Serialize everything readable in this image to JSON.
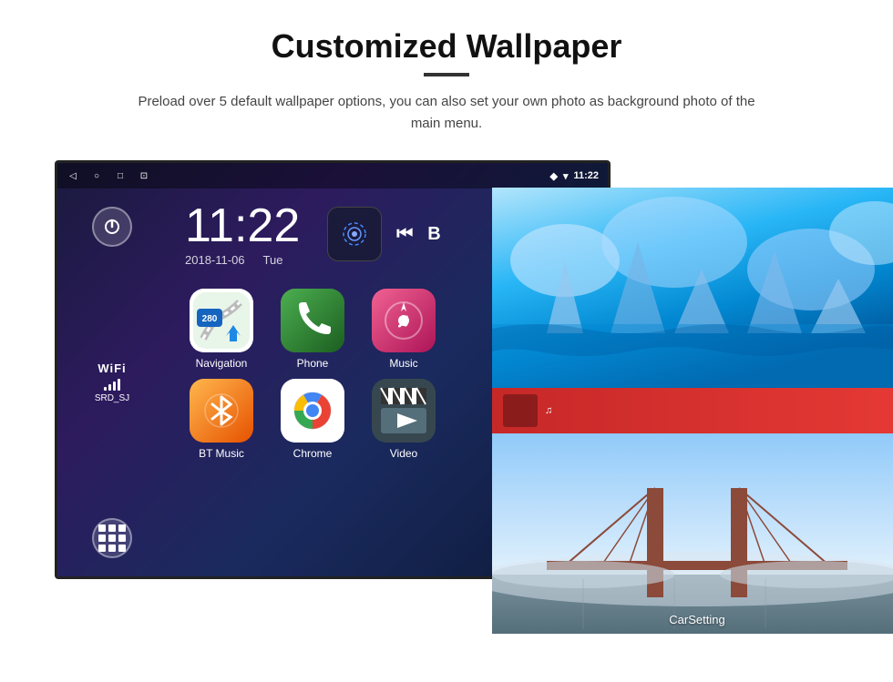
{
  "page": {
    "title": "Customized Wallpaper",
    "subtitle": "Preload over 5 default wallpaper options, you can also set your own photo as background photo of the main menu."
  },
  "android": {
    "time": "11:22",
    "date": "2018-11-06",
    "day": "Tue",
    "wifi_label": "WiFi",
    "wifi_ssid": "SRD_SJ",
    "status_time": "11:22"
  },
  "apps": [
    {
      "label": "Navigation",
      "type": "navigation"
    },
    {
      "label": "Phone",
      "type": "phone"
    },
    {
      "label": "Music",
      "type": "music"
    },
    {
      "label": "BT Music",
      "type": "bt"
    },
    {
      "label": "Chrome",
      "type": "chrome"
    },
    {
      "label": "Video",
      "type": "video"
    }
  ],
  "carsetting": {
    "label": "CarSetting"
  }
}
